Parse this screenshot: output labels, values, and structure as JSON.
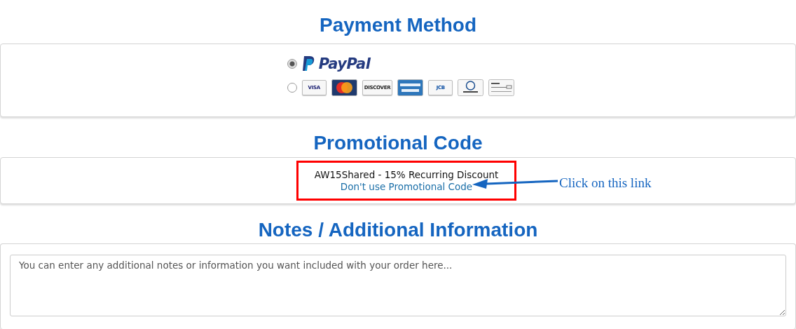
{
  "payment": {
    "title": "Payment Method",
    "options": [
      {
        "kind": "paypal",
        "selected": true,
        "label": "PayPal"
      },
      {
        "kind": "cards",
        "selected": false,
        "cards": [
          {
            "kind": "visa",
            "label": "VISA"
          },
          {
            "kind": "mastercard"
          },
          {
            "kind": "discover",
            "label": "DISCOVER"
          },
          {
            "kind": "amex"
          },
          {
            "kind": "jcb",
            "label": "JCB"
          },
          {
            "kind": "diners"
          },
          {
            "kind": "check"
          }
        ]
      }
    ]
  },
  "promo": {
    "title": "Promotional Code",
    "applied": "AW15Shared - 15% Recurring Discount",
    "link": "Don't use Promotional Code",
    "annotation": "Click on this link"
  },
  "notes": {
    "title": "Notes / Additional Information",
    "placeholder": "You can enter any additional notes or information you want included with your order here..."
  }
}
